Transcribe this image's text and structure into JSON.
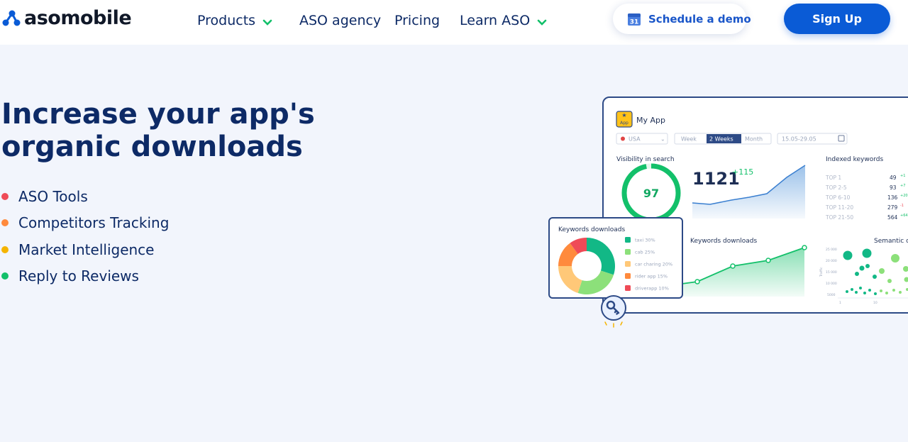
{
  "brand": {
    "name": "asomobile"
  },
  "nav": {
    "items": [
      {
        "label": "Products",
        "has_dropdown": true
      },
      {
        "label": "ASO agency",
        "has_dropdown": false
      },
      {
        "label": "Pricing",
        "has_dropdown": false
      },
      {
        "label": "Learn ASO",
        "has_dropdown": true
      }
    ],
    "demo_label": "Schedule a demo",
    "demo_icon": "calendar-icon",
    "calendar_day": "31",
    "signup_label": "Sign Up"
  },
  "hero": {
    "title": "Increase your app's organic downloads",
    "features": [
      {
        "label": "ASO Tools",
        "color": "#ef4b57"
      },
      {
        "label": "Competitors Tracking",
        "color": "#ff8a3d"
      },
      {
        "label": "Market Intelligence",
        "color": "#f5b400"
      },
      {
        "label": "Reply to Reviews",
        "color": "#13c06a"
      }
    ]
  },
  "dashboard": {
    "app_name": "My App",
    "app_icon_label": "App",
    "country": "USA",
    "periods": [
      "Week",
      "2 Weeks",
      "Month"
    ],
    "active_period": "2 Weeks",
    "date_range": "15.05-29.05",
    "visibility_label": "Visibility in search",
    "visibility_score": "97",
    "visibility_total": "1121",
    "visibility_delta": "+115",
    "indexed_label": "Indexed keywords",
    "indexed_rows": [
      {
        "label": "TOP 1",
        "value": "49",
        "delta": "+1"
      },
      {
        "label": "TOP 2-5",
        "value": "93",
        "delta": "+7"
      },
      {
        "label": "TOP 6-10",
        "value": "136",
        "delta": "+20"
      },
      {
        "label": "TOP 11-20",
        "value": "279",
        "delta": "-1"
      },
      {
        "label": "TOP 21-50",
        "value": "564",
        "delta": "+64"
      }
    ],
    "downloads_label": "Keywords downloads",
    "semantic_label": "Semantic c",
    "semantic_y_ticks": [
      "25 000",
      "20 000",
      "15 000",
      "10 000",
      "5000"
    ],
    "semantic_y_axis": "Traffic",
    "semantic_x_ticks": [
      "1",
      "10"
    ],
    "donut_card": {
      "title": "Keywords downloads",
      "slices": [
        {
          "label": "taxi 30%",
          "value": 30,
          "color": "#12b886"
        },
        {
          "label": "cab 25%",
          "value": 25,
          "color": "#8ce07a"
        },
        {
          "label": "car charing 20%",
          "value": 20,
          "color": "#ffc878"
        },
        {
          "label": "rider app 15%",
          "value": 15,
          "color": "#ff8a3d"
        },
        {
          "label": "driverapp 10%",
          "value": 10,
          "color": "#ef4b57"
        }
      ]
    },
    "key_icon": "key-icon"
  },
  "colors": {
    "brand_blue": "#0a5bd6",
    "navy": "#0d2a66",
    "green": "#13c06a",
    "background": "#f2f5fc"
  }
}
